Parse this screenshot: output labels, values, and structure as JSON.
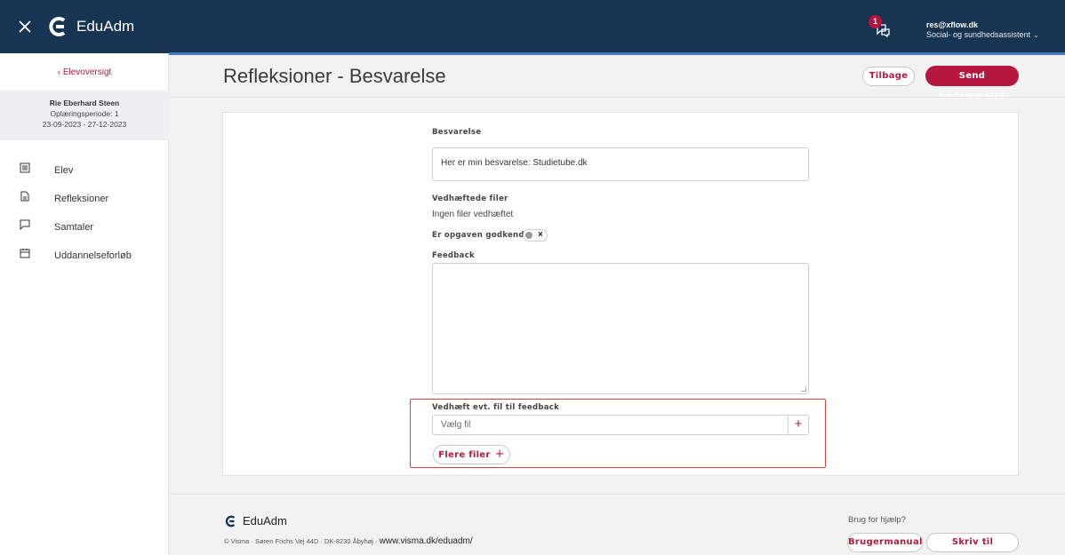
{
  "app": {
    "brand": "EduAdm"
  },
  "header": {
    "notification_count": "1",
    "user_email": "res@xflow.dk",
    "user_role": "Social- og sundhedsassistent",
    "icons": {
      "close": "close-icon",
      "chat": "chat-icon",
      "caret": "chevron-down-icon"
    }
  },
  "sidebar": {
    "back_label": "Elevoversigt",
    "student_name": "Rie Eberhard Steen",
    "period_label": "Oplæringsperiode: 1",
    "period_dates": "23-09-2023 - 27-12-2023",
    "items": [
      {
        "label": "Elev",
        "icon": "student-card-icon"
      },
      {
        "label": "Refleksioner",
        "icon": "document-icon"
      },
      {
        "label": "Samtaler",
        "icon": "chat-bubble-icon"
      },
      {
        "label": "Uddannelseforløb",
        "icon": "calendar-icon"
      }
    ]
  },
  "page": {
    "title": "Refleksioner - Besvarelse",
    "back_button": "Tilbage",
    "send_button": "Send bedømmelse"
  },
  "form": {
    "answer_label": "Besvarelse",
    "answer_value": "Her er min besvarelse: Studietube.dk",
    "attachments_label": "Vedhæftede filer",
    "attachments_value": "Ingen filer vedhæftet",
    "approved_label": "Er opgaven godkendt?",
    "approved": false,
    "feedback_label": "Feedback",
    "feedback_value": "",
    "attach_label": "Vedhæft evt. fil til feedback",
    "file_placeholder": "Vælg fil",
    "more_files_button": "Flere filer"
  },
  "footer": {
    "brand": "EduAdm",
    "address": "© Visma · Søren Frichs Vej 44D · DK-8230 Åbyhøj ·",
    "url": "www.visma.dk/eduadm/",
    "help_label": "Brug for hjælp?",
    "manual_button": "Brugermanual",
    "support_button": "Skriv til supporten"
  },
  "colors": {
    "topbar": "#173451",
    "accent": "#b5173f",
    "highlight": "#e0403f"
  }
}
